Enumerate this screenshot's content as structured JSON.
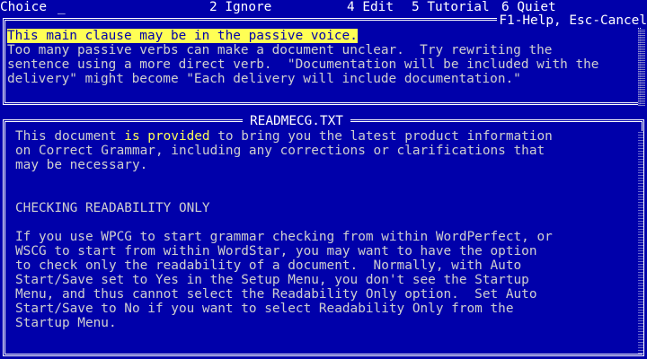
{
  "menu": {
    "choice_label": "Choice",
    "cursor": "_",
    "items": [
      {
        "label": "2 Ignore"
      },
      {
        "label": "4 Edit"
      },
      {
        "label": "5 Tutorial"
      },
      {
        "label": "6 Quiet"
      }
    ]
  },
  "message": {
    "help_hint": "F1-Help, Esc-Cancel",
    "headline": "This main clause may be in the passive voice.",
    "lines": [
      "Too many passive verbs can make a document unclear.  Try rewriting the",
      "sentence using a more direct verb.  \"Documentation will be included with the",
      "delivery\" might become \"Each delivery will include documentation.\""
    ]
  },
  "document": {
    "title": "READMECG.TXT",
    "line1_before": "This document ",
    "line1_highlight": "is provided",
    "line1_after": " to bring you the latest product information",
    "lines": [
      "on Correct Grammar, including any corrections or clarifications that",
      "may be necessary."
    ],
    "heading": "CHECKING READABILITY ONLY",
    "paragraph": [
      "If you use WPCG to start grammar checking from within WordPerfect, or",
      "WSCG to start from within WordStar, you may want to have the option",
      "to check only the readability of a document.  Normally, with Auto",
      "Start/Save set to Yes in the Setup Menu, you don't see the Startup",
      "Menu, and thus cannot select the Readability Only option.  Set Auto",
      "Start/Save to No if you want to select Readability Only from the",
      "Startup Menu."
    ]
  },
  "colors": {
    "background": "#0000aa",
    "text": "#e8e8e8",
    "highlight": "#ffff55"
  }
}
